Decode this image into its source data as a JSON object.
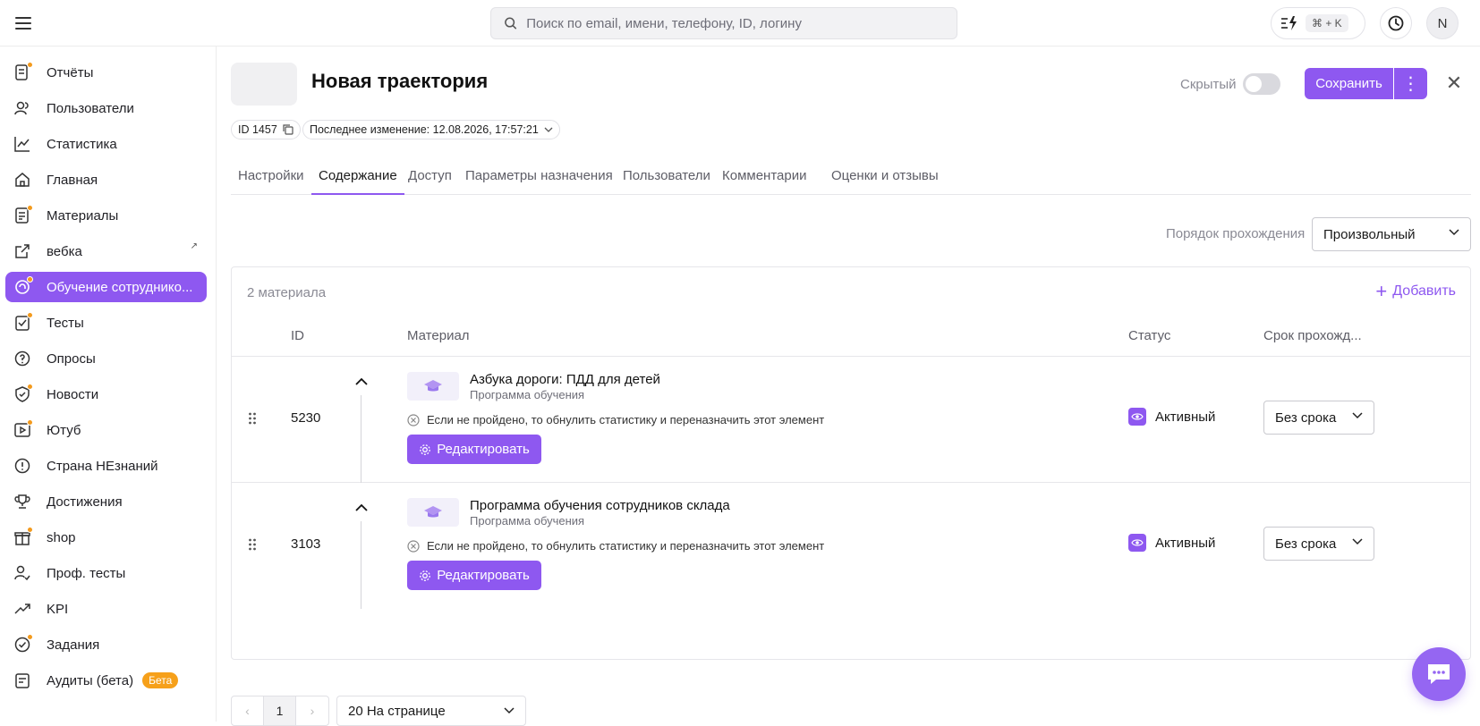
{
  "search": {
    "placeholder": "Поиск по email, имени, телефону, ID, логину"
  },
  "quick_action": {
    "shortcut": "⌘ + K"
  },
  "user": {
    "initial": "N"
  },
  "sidebar": {
    "items": [
      {
        "label": "Отчёты",
        "icon": "report-icon"
      },
      {
        "label": "Пользователи",
        "icon": "users-icon"
      },
      {
        "label": "Статистика",
        "icon": "chart-icon"
      },
      {
        "label": "Главная",
        "icon": "home-icon"
      },
      {
        "label": "Материалы",
        "icon": "materials-icon"
      },
      {
        "label": "вебка",
        "icon": "external-link-icon"
      },
      {
        "label": "Обучение сотруднико...",
        "icon": "learning-icon"
      },
      {
        "label": "Тесты",
        "icon": "tests-icon"
      },
      {
        "label": "Опросы",
        "icon": "survey-icon"
      },
      {
        "label": "Новости",
        "icon": "news-icon"
      },
      {
        "label": "Ютуб",
        "icon": "video-icon"
      },
      {
        "label": "Страна НЕзнаний",
        "icon": "alert-icon"
      },
      {
        "label": "Достижения",
        "icon": "trophy-icon"
      },
      {
        "label": "shop",
        "icon": "gift-icon"
      },
      {
        "label": "Проф. тесты",
        "icon": "user-check-icon"
      },
      {
        "label": "KPI",
        "icon": "trend-icon"
      },
      {
        "label": "Задания",
        "icon": "task-icon"
      },
      {
        "label": "Аудиты (бета)",
        "icon": "audit-icon",
        "badge": "Бета"
      }
    ]
  },
  "header": {
    "title": "Новая траектория",
    "id_chip": "ID 1457",
    "last_change": "Последнее изменение: 12.08.2026, 17:57:21",
    "hidden_label": "Скрытый",
    "save_label": "Сохранить"
  },
  "tabs": [
    "Настройки",
    "Содержание",
    "Доступ",
    "Параметры назначения",
    "Пользователи",
    "Комментарии",
    "Оценки и отзывы"
  ],
  "order": {
    "label": "Порядок прохождения",
    "value": "Произвольный"
  },
  "panel": {
    "count": "2 материала",
    "add_label": "Добавить",
    "columns": {
      "id": "ID",
      "material": "Материал",
      "status": "Статус",
      "deadline": "Срок прохожд..."
    }
  },
  "rows": [
    {
      "id": "5230",
      "name": "Азбука дороги: ПДД для детей",
      "type": "Программа обучения",
      "condition": "Если не пройдено, то обнулить статистику и переназначить этот элемент",
      "edit_label": "Редактировать",
      "status": "Активный",
      "deadline": "Без срока"
    },
    {
      "id": "3103",
      "name": "Программа обучения сотрудников склада",
      "type": "Программа обучения",
      "condition": "Если не пройдено, то обнулить статистику и переназначить этот элемент",
      "edit_label": "Редактировать",
      "status": "Активный",
      "deadline": "Без срока"
    }
  ],
  "pagination": {
    "prev": "‹",
    "current": "1",
    "next": "›",
    "per_page": "20 На странице"
  },
  "colors": {
    "accent": "#8e58f0",
    "badge": "#f6a01a"
  }
}
